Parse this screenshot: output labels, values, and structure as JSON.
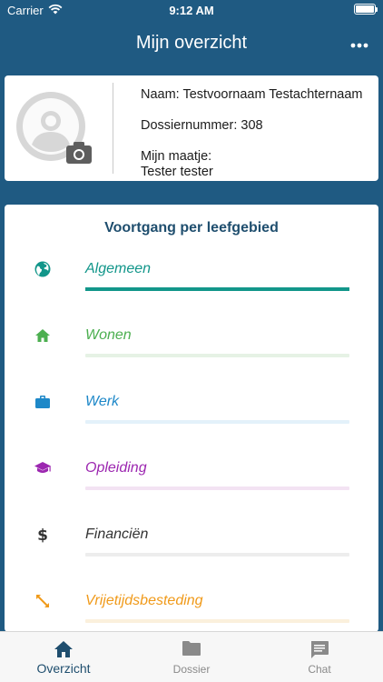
{
  "status_bar": {
    "carrier": "Carrier",
    "time": "9:12 AM",
    "battery_level": 1.0
  },
  "header": {
    "title": "Mijn overzicht",
    "more_icon": "more-horizontal-icon"
  },
  "profile": {
    "name_line": "Naam: Testvoornaam Testachternaam",
    "dossier_line": "Dossiernummer: 308",
    "buddy_label": "Mijn maatje:",
    "buddy_name": "Tester tester",
    "avatar_icon": "user-avatar-icon",
    "camera_icon": "camera-icon"
  },
  "progress": {
    "title": "Voortgang per leefgebied",
    "areas": [
      {
        "label": "Algemeen",
        "icon": "globe-icon",
        "color": "#12968a",
        "track_color": "#cfe9e6",
        "progress": 1.0
      },
      {
        "label": "Wonen",
        "icon": "home-icon",
        "color": "#4caf50",
        "track_color": "#e6f2e5",
        "progress": 0.0
      },
      {
        "label": "Werk",
        "icon": "briefcase-icon",
        "color": "#1e88c8",
        "track_color": "#e3f1fa",
        "progress": 0.0
      },
      {
        "label": "Opleiding",
        "icon": "graduation-cap-icon",
        "color": "#9c27b0",
        "track_color": "#f3e3f3",
        "progress": 0.0
      },
      {
        "label": "Financiën",
        "icon": "dollar-icon",
        "color": "#333333",
        "track_color": "#ededed",
        "progress": 0.0
      },
      {
        "label": "Vrijetijdsbesteding",
        "icon": "expand-arrows-icon",
        "color": "#f09a1a",
        "track_color": "#fbf0dc",
        "progress": 0.0
      }
    ]
  },
  "tabs": [
    {
      "label": "Overzicht",
      "icon": "home-icon",
      "active": true
    },
    {
      "label": "Dossier",
      "icon": "folder-icon",
      "active": false
    },
    {
      "label": "Chat",
      "icon": "chat-icon",
      "active": false
    }
  ],
  "colors": {
    "header_bg": "#1f5a82",
    "title_text": "#1f4e6e",
    "inactive_tab": "#8a8a8a"
  }
}
